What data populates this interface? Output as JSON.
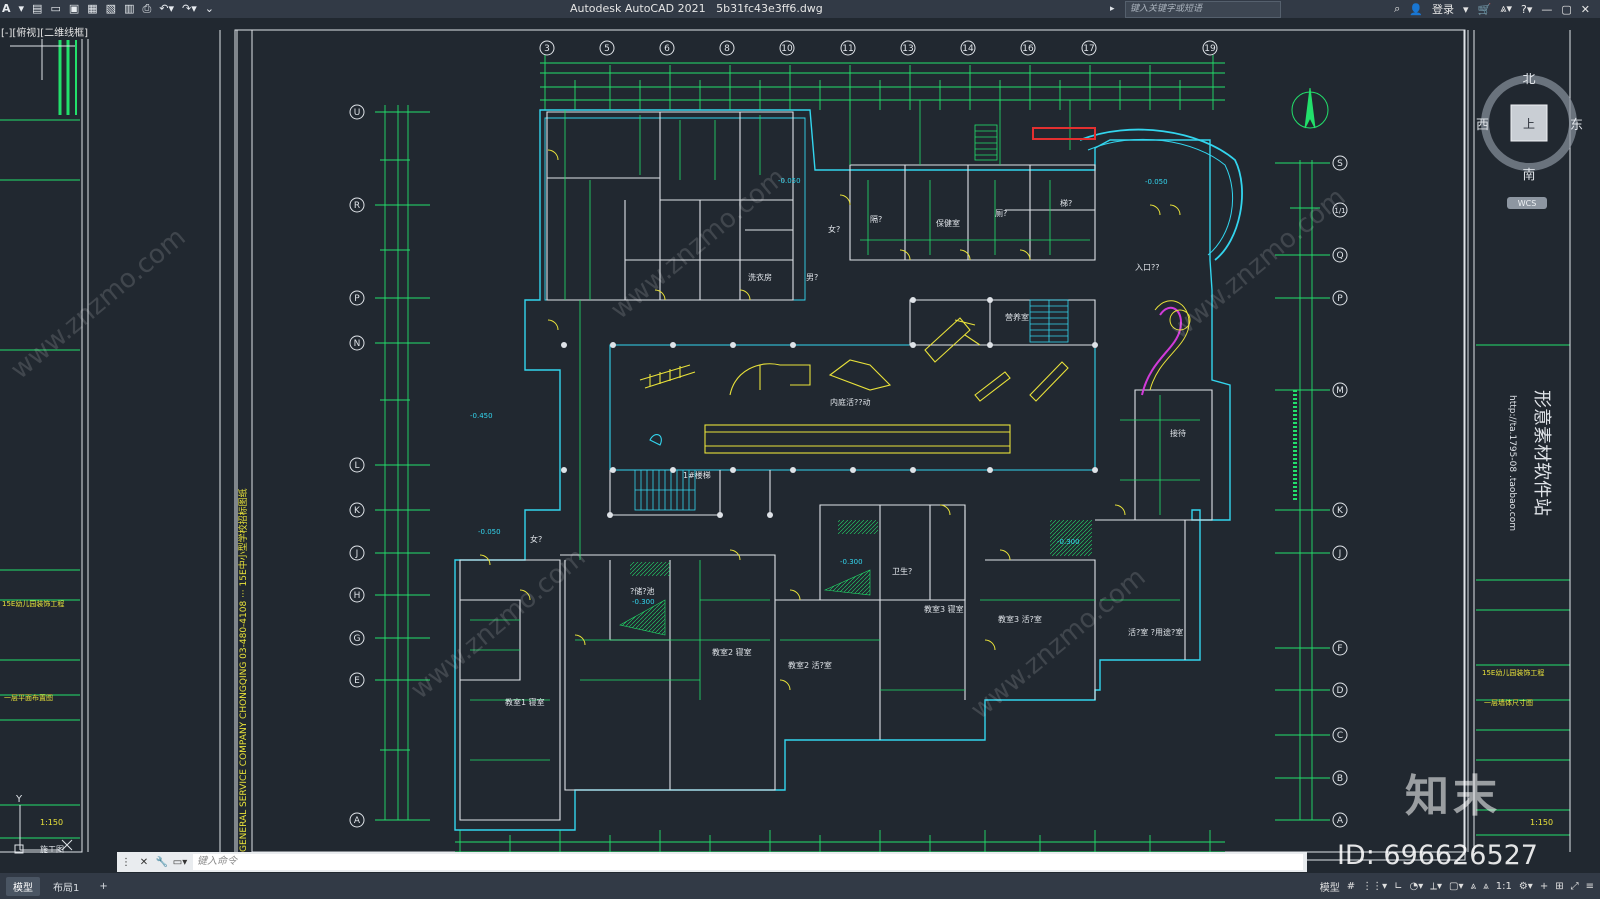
{
  "app": {
    "title": "Autodesk AutoCAD 2021",
    "file": "5b31fc43e3ff6.dwg",
    "search_placeholder": "键入关键字或短语",
    "login": "登录",
    "viewport_label": "[-][俯视][二维线框]"
  },
  "viewcube": {
    "north": "北",
    "south": "南",
    "west": "西",
    "east": "东",
    "top": "上",
    "wcs": "WCS"
  },
  "grid": {
    "top": [
      "3",
      "5",
      "6",
      "8",
      "10",
      "11",
      "13",
      "14",
      "16",
      "17",
      "19"
    ],
    "left": [
      "U",
      "R",
      "P",
      "N",
      "L",
      "K",
      "J",
      "H",
      "G",
      "E",
      "A"
    ],
    "right": [
      "S",
      "1/1",
      "Q",
      "P",
      "M",
      "K",
      "J",
      "F",
      "D",
      "C",
      "B",
      "A"
    ]
  },
  "rooms": [
    "保健室",
    "厕?",
    "女?",
    "洗衣房",
    "隔?",
    "门卫",
    "男?",
    "入口??",
    "内庭活??动",
    "营养室",
    "梯?",
    "1#楼梯",
    "教室1 寝室",
    "教室2 寝室",
    "教室2 活?室",
    "教室3 寝室",
    "教室3 活?室",
    "活?室 ?用途?室",
    "?储?池",
    "卫生?",
    "接待"
  ],
  "dims": [
    "-0.050",
    "-0.450",
    "-0.300",
    "1:150"
  ],
  "sheets": {
    "left": {
      "project": "15E幼儿园装饰工程",
      "drawing": "一层平面布置图",
      "scale": "1:150",
      "mark": "施工图"
    },
    "right": {
      "project": "15E幼儿园装饰工程",
      "drawing": "一层墙体尺寸图",
      "scale": "1:150",
      "stamp": "形意素材软件站"
    }
  },
  "cmd": {
    "placeholder": "键入命令"
  },
  "status": {
    "tabs": [
      "模型",
      "布局1"
    ],
    "model": "模型",
    "scale": "1:1"
  },
  "watermark": {
    "brand": "知末",
    "id": "ID: 696626527",
    "site": "www.znzmo.com"
  },
  "colors": {
    "bg": "#212830",
    "green": "#22e06b",
    "cyan": "#33d5ee",
    "yellow": "#e9e23a",
    "white": "#dfe3e8",
    "magenta": "#d13bd8",
    "red": "#e33030"
  }
}
